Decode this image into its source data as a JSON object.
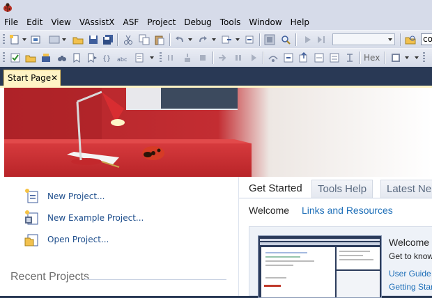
{
  "menu": [
    "File",
    "Edit",
    "View",
    "VAssistX",
    "ASF",
    "Project",
    "Debug",
    "Tools",
    "Window",
    "Help"
  ],
  "toolbar": {
    "search_value": "cor",
    "hex_label": "Hex"
  },
  "document_tab": {
    "label": "Start Page",
    "close_glyph": "✕"
  },
  "start_actions": [
    {
      "label": "New Project..."
    },
    {
      "label": "New Example Project..."
    },
    {
      "label": "Open Project..."
    }
  ],
  "recent_projects_title": "Recent Projects",
  "main_tabs": [
    {
      "label": "Get Started",
      "active": true
    },
    {
      "label": "Tools Help",
      "active": false
    },
    {
      "label": "Latest Ne",
      "active": false
    }
  ],
  "sub_tabs": [
    {
      "label": "Welcome",
      "active": true
    },
    {
      "label": "Links and Resources",
      "active": false
    }
  ],
  "welcome_panel": {
    "title": "Welcome t",
    "subtitle": "Get to know",
    "links": [
      "User Guide",
      "Getting Star"
    ]
  },
  "colors": {
    "accent_link": "#1e4e8c",
    "tab_active": "#fff3c5",
    "frame": "#293955",
    "hero_red": "#c92e33"
  }
}
